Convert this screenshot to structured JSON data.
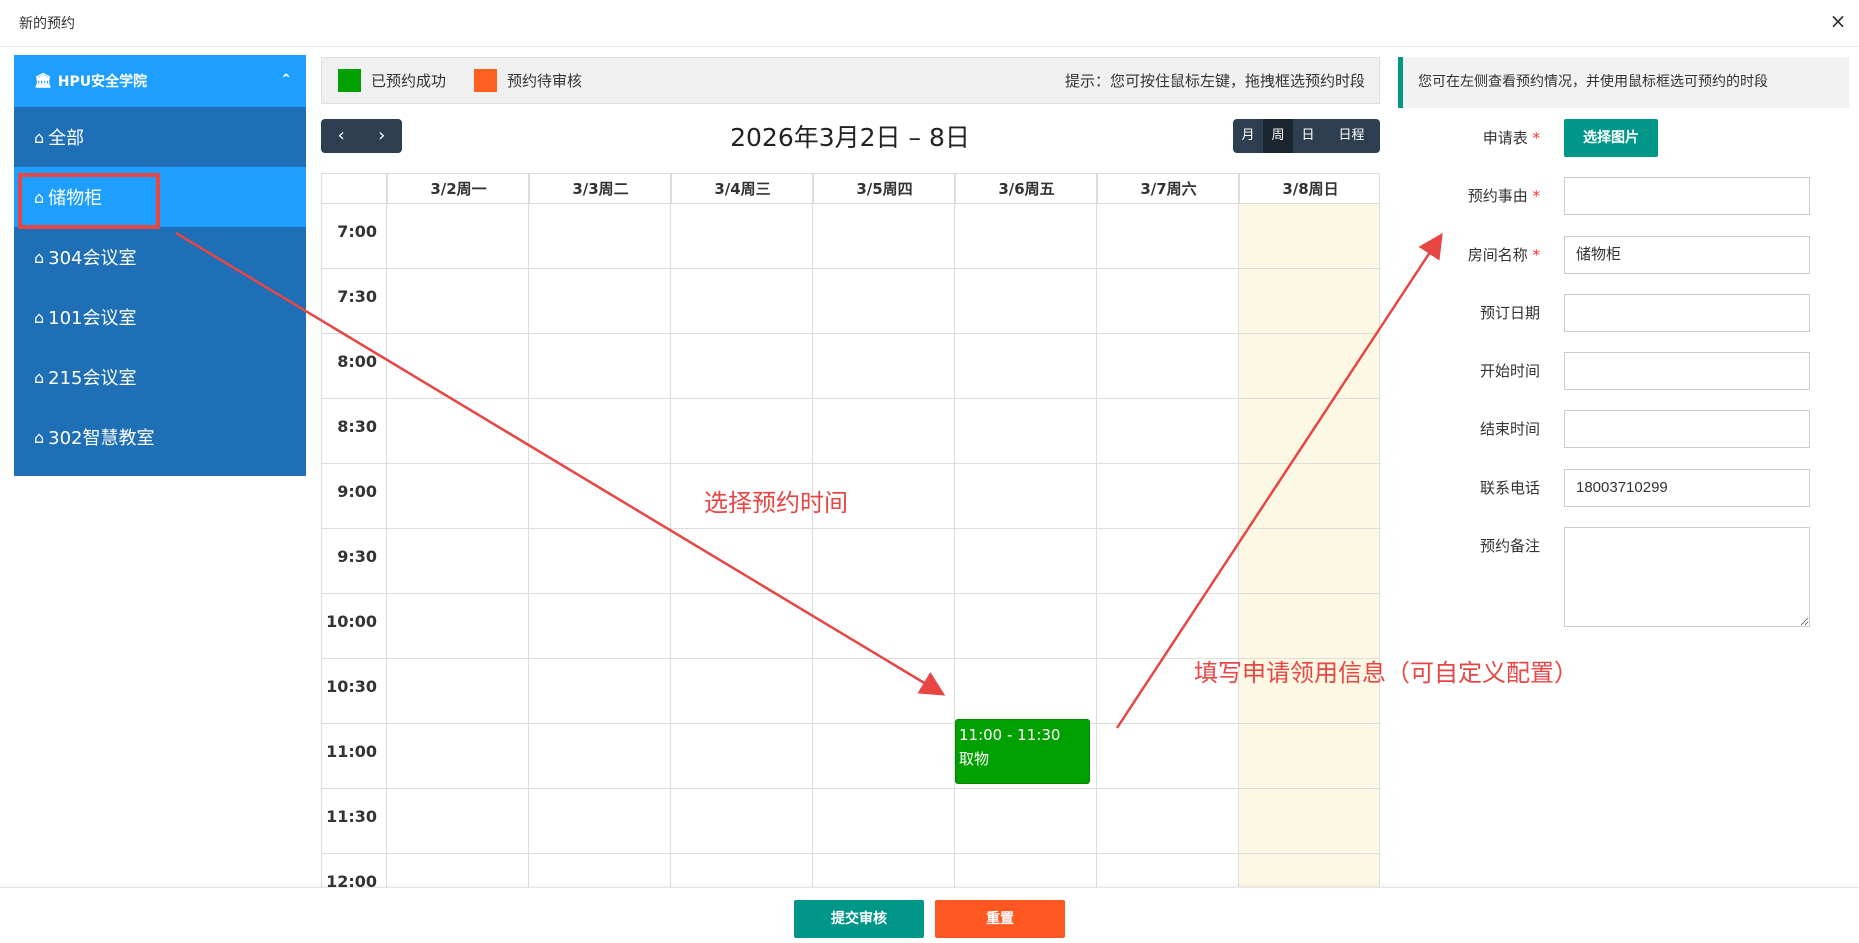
{
  "window": {
    "title": "新的预约",
    "close_icon": "×"
  },
  "sidebar": {
    "header": "HPU安全学院",
    "items": [
      {
        "label": "全部",
        "active": false
      },
      {
        "label": "储物柜",
        "active": true
      },
      {
        "label": "304会议室",
        "active": false
      },
      {
        "label": "101会议室",
        "active": false
      },
      {
        "label": "215会议室",
        "active": false
      },
      {
        "label": "302智慧教室",
        "active": false
      }
    ]
  },
  "legend": {
    "success_label": "已预约成功",
    "success_color": "#00a000",
    "pending_label": "预约待审核",
    "pending_color": "#ff5f1f",
    "hint": "提示：您可按住鼠标左键，拖拽框选预约时段"
  },
  "calendar": {
    "range_title": "2026年3月2日 – 8日",
    "prev_label": "‹",
    "next_label": "›",
    "views": [
      "月",
      "周",
      "日",
      "日程"
    ],
    "active_view": "周",
    "days": [
      "3/2周一",
      "3/3周二",
      "3/4周三",
      "3/5周四",
      "3/6周五",
      "3/7周六",
      "3/8周日"
    ],
    "today_index": 6,
    "times": [
      "7:00",
      "7:30",
      "8:00",
      "8:30",
      "9:00",
      "9:30",
      "10:00",
      "10:30",
      "11:00",
      "11:30",
      "12:00"
    ],
    "event": {
      "time": "11:00 - 11:30",
      "title": "取物",
      "day_index": 4,
      "status": "success"
    }
  },
  "form": {
    "notice": "您可在左侧查看预约情况，并使用鼠标框选可预约的时段",
    "fields": [
      {
        "label": "申请表",
        "required": true,
        "button": "选择图片"
      },
      {
        "label": "预约事由",
        "required": true,
        "value": ""
      },
      {
        "label": "房间名称",
        "required": true,
        "value": "储物柜"
      },
      {
        "label": "预订日期",
        "required": false,
        "value": ""
      },
      {
        "label": "开始时间",
        "required": false,
        "value": ""
      },
      {
        "label": "结束时间",
        "required": false,
        "value": ""
      },
      {
        "label": "联系电话",
        "required": false,
        "value": "18003710299"
      },
      {
        "label": "预约备注",
        "required": false,
        "value": ""
      }
    ]
  },
  "footer": {
    "submit_label": "提交审核",
    "reset_label": "重置"
  },
  "annotations": {
    "select_time": "选择预约时间",
    "fill_info": "填写申请领用信息（可自定义配置）",
    "color": "#e84545"
  }
}
